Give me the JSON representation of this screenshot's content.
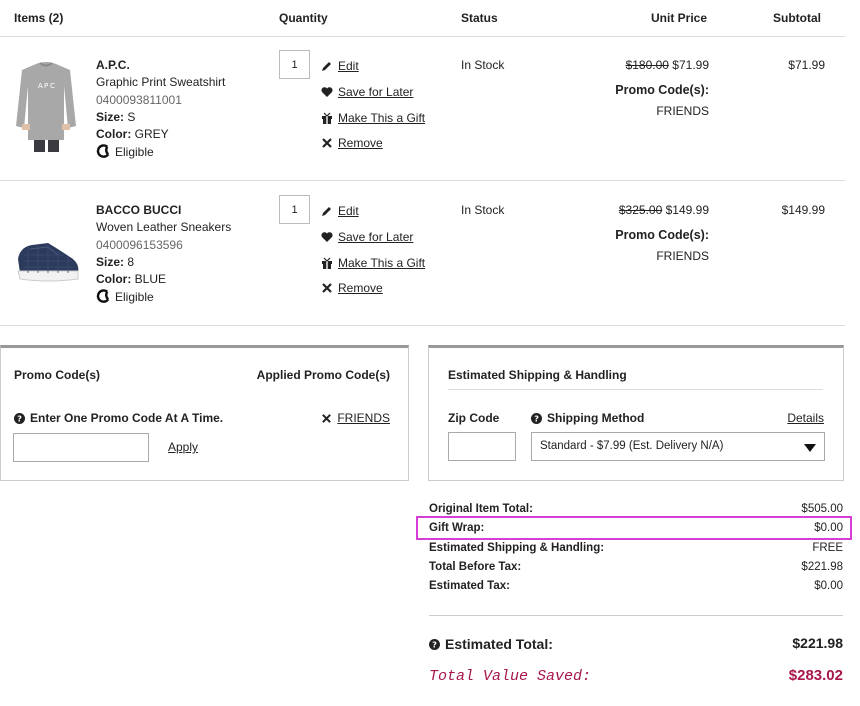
{
  "headers": {
    "items": "Items (2)",
    "quantity": "Quantity",
    "status": "Status",
    "unit_price": "Unit Price",
    "subtotal": "Subtotal"
  },
  "items": [
    {
      "brand": "A.P.C.",
      "name": "Graphic Print Sweatshirt",
      "sku": "0400093811001",
      "size_label": "Size:",
      "size": "S",
      "color_label": "Color:",
      "color": "GREY",
      "eligible": "Eligible",
      "quantity": "1",
      "actions": {
        "edit": "Edit",
        "save": "Save for Later",
        "gift": "Make This a Gift",
        "remove": "Remove"
      },
      "status": "In Stock",
      "original_price": "$180.00",
      "sale_price": "$71.99",
      "promo_label": "Promo Code(s):",
      "promo_code": "FRIENDS",
      "subtotal": "$71.99"
    },
    {
      "brand": "BACCO BUCCI",
      "name": "Woven Leather Sneakers",
      "sku": "0400096153596",
      "size_label": "Size:",
      "size": "8",
      "color_label": "Color:",
      "color": "BLUE",
      "eligible": "Eligible",
      "quantity": "1",
      "actions": {
        "edit": "Edit",
        "save": "Save for Later",
        "gift": "Make This a Gift",
        "remove": "Remove"
      },
      "status": "In Stock",
      "original_price": "$325.00",
      "sale_price": "$149.99",
      "promo_label": "Promo Code(s):",
      "promo_code": "FRIENDS",
      "subtotal": "$149.99"
    }
  ],
  "promo_panel": {
    "title": "Promo Code(s)",
    "applied_title": "Applied Promo Code(s)",
    "hint": "Enter One Promo Code At A Time.",
    "input_value": "",
    "apply": "Apply",
    "applied_code": "FRIENDS"
  },
  "shipping_panel": {
    "title": "Estimated Shipping & Handling",
    "zip_label": "Zip Code",
    "zip_value": "",
    "method_label": "Shipping Method",
    "details": "Details",
    "method_selected": "Standard - $7.99 (Est. Delivery N/A)"
  },
  "summary": {
    "original_total_label": "Original Item Total:",
    "original_total": "$505.00",
    "gift_wrap_label": "Gift Wrap:",
    "gift_wrap": "$0.00",
    "shipping_label": "Estimated Shipping & Handling:",
    "shipping": "FREE",
    "before_tax_label": "Total Before Tax:",
    "before_tax": "$221.98",
    "tax_label": "Estimated Tax:",
    "tax": "$0.00",
    "estimated_total_label": "Estimated Total:",
    "estimated_total": "$221.98",
    "saved_label": "Total Value Saved:",
    "saved": "$283.02"
  },
  "colors": {
    "highlight": "#d63fd6",
    "saved": "#a8174d"
  }
}
